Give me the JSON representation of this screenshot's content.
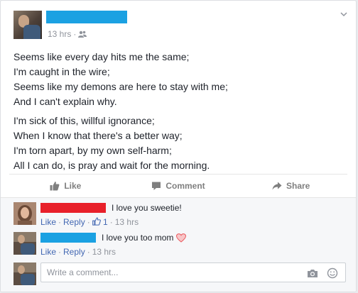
{
  "post": {
    "timestamp": "13 hrs",
    "meta_sep": "·",
    "stanzas": [
      [
        "Seems like every day hits me the same;",
        "I'm caught in the wire;",
        "Seems like my demons are here to stay with me;",
        "And I can't explain why."
      ],
      [
        "I'm sick of this, willful ignorance;",
        "When I know that there's a better way;",
        "I'm torn apart, by my own self-harm;",
        "All I can do, is pray and wait for the morning."
      ]
    ]
  },
  "actions": {
    "like": "Like",
    "comment": "Comment",
    "share": "Share"
  },
  "comments": [
    {
      "text": "I love you sweetie!",
      "like": "Like",
      "reply": "Reply",
      "sep": "·",
      "like_count": "1",
      "time": "13 hrs",
      "redaction_color": "#e8202a"
    },
    {
      "text": "I love you too mom",
      "like": "Like",
      "reply": "Reply",
      "sep": "·",
      "time": "13 hrs",
      "redaction_color": "#1ba1e2"
    }
  ],
  "composer": {
    "placeholder": "Write a comment..."
  },
  "colors": {
    "link": "#4267b2",
    "name_redaction": "#1ba1e2",
    "heart": "#e9595e"
  },
  "icons": [
    "audience-icon",
    "chevron-down-icon",
    "like-icon",
    "comment-icon",
    "share-icon",
    "camera-icon",
    "emoji-icon"
  ]
}
